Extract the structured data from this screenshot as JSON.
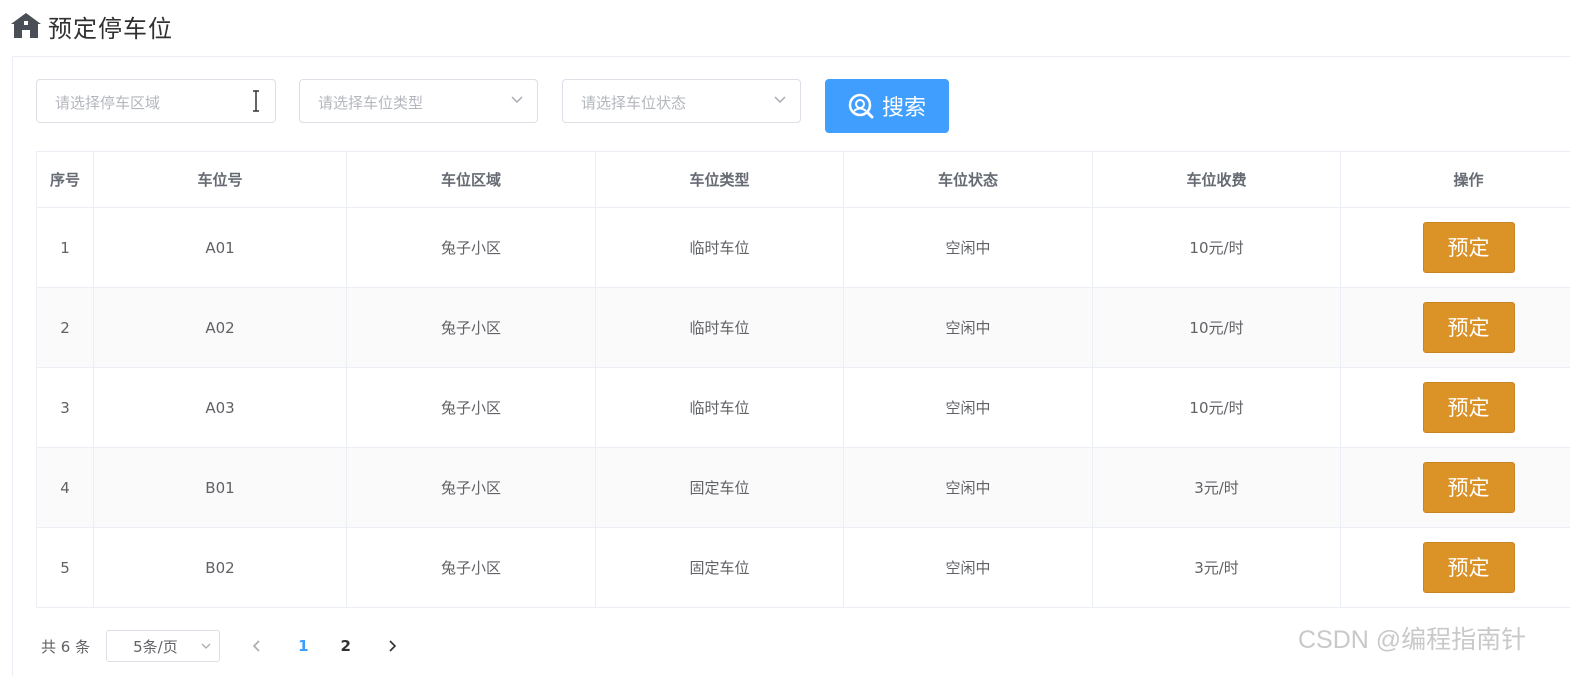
{
  "header": {
    "title": "预定停车位",
    "icon": "home-icon"
  },
  "filters": {
    "area_placeholder": "请选择停车区域",
    "type_placeholder": "请选择车位类型",
    "status_placeholder": "请选择车位状态"
  },
  "search": {
    "label": "搜索",
    "icon": "search-icon"
  },
  "table": {
    "columns": [
      "序号",
      "车位号",
      "车位区域",
      "车位类型",
      "车位状态",
      "车位收费",
      "操作"
    ],
    "rows": [
      {
        "index": "1",
        "number": "A01",
        "area": "兔子小区",
        "type": "临时车位",
        "status": "空闲中",
        "fee": "10元/时",
        "action": "预定"
      },
      {
        "index": "2",
        "number": "A02",
        "area": "兔子小区",
        "type": "临时车位",
        "status": "空闲中",
        "fee": "10元/时",
        "action": "预定"
      },
      {
        "index": "3",
        "number": "A03",
        "area": "兔子小区",
        "type": "临时车位",
        "status": "空闲中",
        "fee": "10元/时",
        "action": "预定"
      },
      {
        "index": "4",
        "number": "B01",
        "area": "兔子小区",
        "type": "固定车位",
        "status": "空闲中",
        "fee": "3元/时",
        "action": "预定"
      },
      {
        "index": "5",
        "number": "B02",
        "area": "兔子小区",
        "type": "固定车位",
        "status": "空闲中",
        "fee": "3元/时",
        "action": "预定"
      }
    ]
  },
  "pagination": {
    "total_label": "共 6 条",
    "page_size": "5条/页",
    "pages": [
      "1",
      "2"
    ],
    "current_page": "1"
  },
  "watermark": "CSDN @编程指南针",
  "colors": {
    "primary": "#409eff",
    "book_button": "#db9227"
  }
}
